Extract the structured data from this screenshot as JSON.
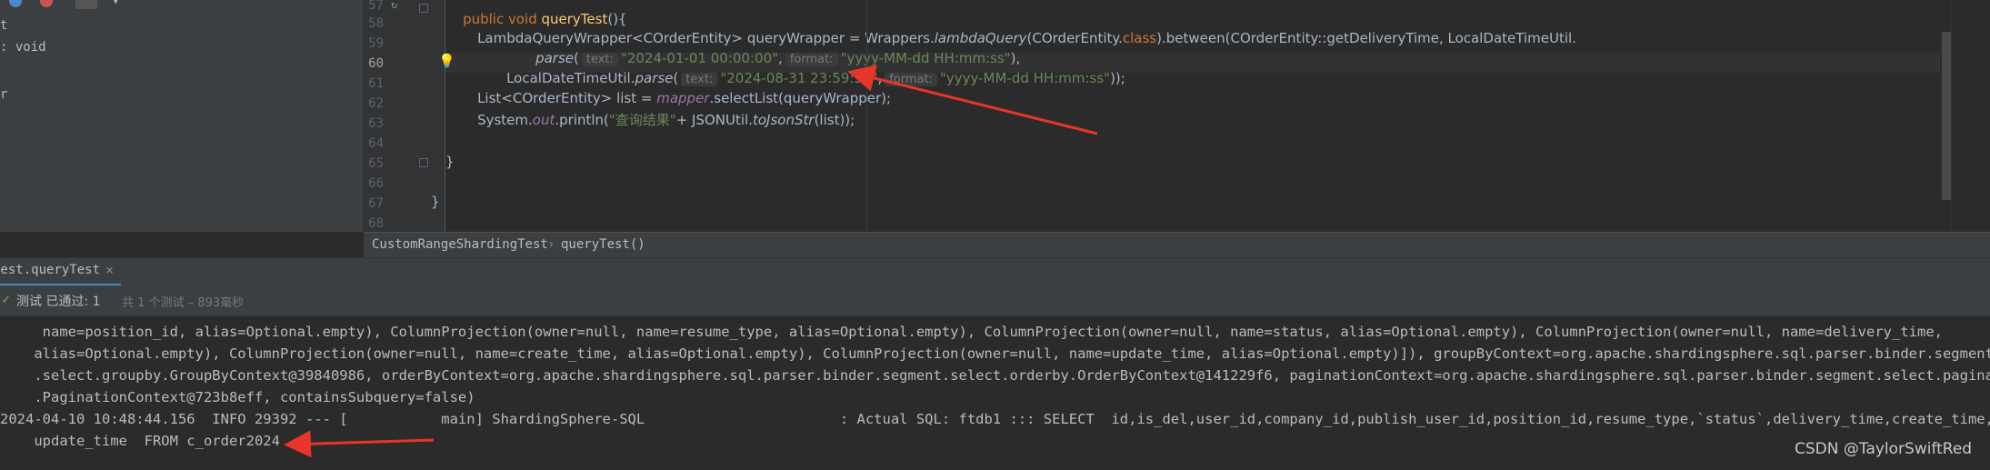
{
  "left_panel": {
    "lines": [
      "t",
      ": void",
      "",
      "r"
    ]
  },
  "editor": {
    "line_numbers": [
      "57",
      "58",
      "59",
      "60",
      "61",
      "62",
      "63",
      "64",
      "65",
      "66",
      "67",
      "68"
    ],
    "line57": {
      "kw": "public void ",
      "fn": "queryTest",
      "rest": "(){"
    },
    "line58": {
      "a": "LambdaQueryWrapper",
      "b": "<COrderEntity> queryWrapper = Wrappers.",
      "c": "lambdaQuery",
      "d": "(COrderEntity.",
      "e": "class",
      "f": ").between(COrderEntity::getDeliveryTime, LocalDateTimeUtil."
    },
    "line59": {
      "a": "parse",
      "b": "(",
      "hint1": "text:",
      "s1": "\"2024-01-01 00:00:00\"",
      "c": ",",
      "hint2": "format:",
      "s2": "\"yyyy-MM-dd HH:mm:ss\"",
      "d": "),"
    },
    "line60": {
      "a": "LocalDateTimeUtil.",
      "b": "parse",
      "c": "(",
      "hint1": "text:",
      "s1": "\"2024-08-31 23:59:59\"",
      "d": ",",
      "hint2": "format:",
      "s2": "\"yyyy-MM-dd HH:mm:ss\"",
      "e": "));"
    },
    "line61": {
      "a": "List<COrderEntity> list = ",
      "b": "mapper",
      "c": ".selectList(queryWrapper);"
    },
    "line62": {
      "a": "System.",
      "b": "out",
      "c": ".println(",
      "s": "\"查询结果\"",
      "d": "+ JSONUtil.",
      "e": "toJsonStr",
      "f": "(list));"
    },
    "line65": "}",
    "line67": "}"
  },
  "breadcrumb": {
    "class": "CustomRangeShardingTest",
    "sep": "›",
    "method": "queryTest()"
  },
  "run_tab": {
    "label": "Test.queryTest",
    "close": "×"
  },
  "status": {
    "check": "✓",
    "text": "测试 已通过: 1",
    "sub": "共 1 个测试 – 893毫秒"
  },
  "console": {
    "lines": [
      "     name=position_id, alias=Optional.empty), ColumnProjection(owner=null, name=resume_type, alias=Optional.empty), ColumnProjection(owner=null, name=status, alias=Optional.empty), ColumnProjection(owner=null, name=delivery_time,",
      "    alias=Optional.empty), ColumnProjection(owner=null, name=create_time, alias=Optional.empty), ColumnProjection(owner=null, name=update_time, alias=Optional.empty)]), groupByContext=org.apache.shardingsphere.sql.parser.binder.segment",
      "    .select.groupby.GroupByContext@39840986, orderByContext=org.apache.shardingsphere.sql.parser.binder.segment.select.orderby.OrderByContext@141229f6, paginationContext=org.apache.shardingsphere.sql.parser.binder.segment.select.pagination",
      "    .PaginationContext@723b8eff, containsSubquery=false)",
      "2024-04-10 10:48:44.156  INFO 29392 --- [           main] ShardingSphere-SQL                       : Actual SQL: ftdb1 ::: SELECT  id,is_del,user_id,company_id,publish_user_id,position_id,resume_type,`status`,delivery_time,create_time,",
      "    update_time  FROM c_order2024"
    ]
  },
  "watermark": "CSDN @TaylorSwiftRed",
  "colors": {
    "keyword": "#cc7832",
    "string": "#6a8759",
    "function": "#ffc66d",
    "arrow": "#e8342a",
    "bg": "#2b2b2b"
  }
}
